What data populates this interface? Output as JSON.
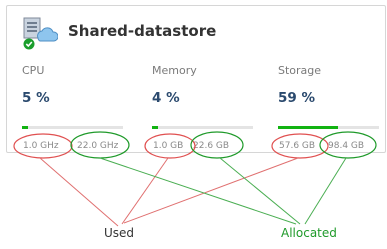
{
  "datastore": {
    "name": "Shared-datastore",
    "status_icon": "green-checkmark-icon",
    "type_icon": "server-cloud-icon"
  },
  "metrics": [
    {
      "label": "CPU",
      "percent": "5 %",
      "fill_fraction": 0.05,
      "used": "1.0 GHz",
      "allocated": "22.0 GHz"
    },
    {
      "label": "Memory",
      "percent": "4 %",
      "fill_fraction": 0.04,
      "used": "1.0 GB",
      "allocated": "22.6 GB"
    },
    {
      "label": "Storage",
      "percent": "59 %",
      "fill_fraction": 0.59,
      "used": "57.6 GB",
      "allocated": "98.4 GB"
    }
  ],
  "annotations": {
    "used_label": "Used",
    "allocated_label": "Allocated",
    "used_color": "#e05050",
    "allocated_color": "#1f9a2a"
  },
  "colors": {
    "bar_fill": "#11b311",
    "bar_track": "#e4e4e4",
    "percent_text": "#2b4a6e"
  }
}
